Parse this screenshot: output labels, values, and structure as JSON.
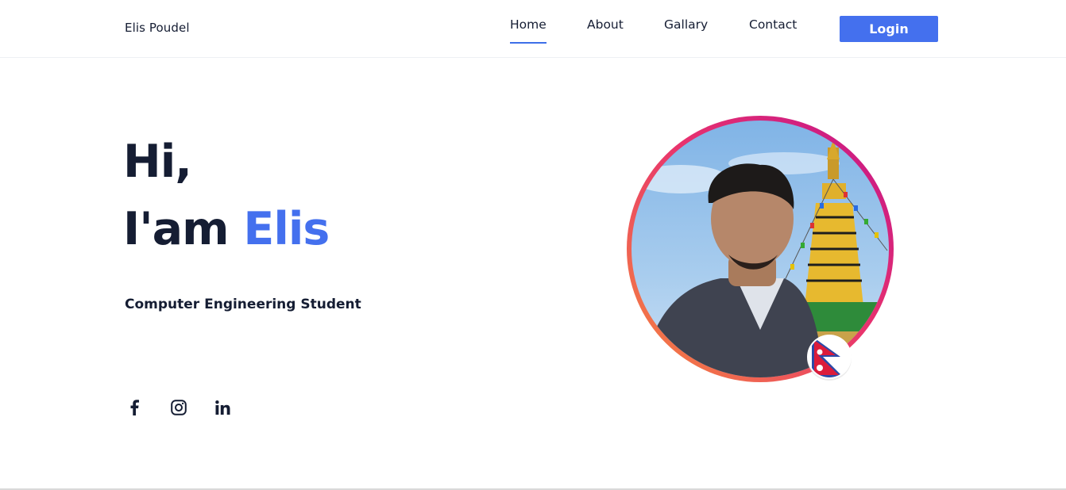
{
  "nav": {
    "brand": "Elis Poudel",
    "links": [
      {
        "label": "Home",
        "active": true
      },
      {
        "label": "About",
        "active": false
      },
      {
        "label": "Gallary",
        "active": false
      },
      {
        "label": "Contact",
        "active": false
      }
    ],
    "login_label": "Login"
  },
  "hero": {
    "greeting": "Hi,",
    "iam_prefix": "I'am",
    "name": "Elis",
    "subtitle": "Computer Engineering Student"
  },
  "social": {
    "icons": [
      "facebook-icon",
      "instagram-icon",
      "linkedin-icon"
    ]
  },
  "colors": {
    "accent": "#4470ee",
    "text": "#151d33",
    "ring_gradient": [
      "#f58a3c",
      "#e8326e",
      "#c2148a"
    ]
  }
}
